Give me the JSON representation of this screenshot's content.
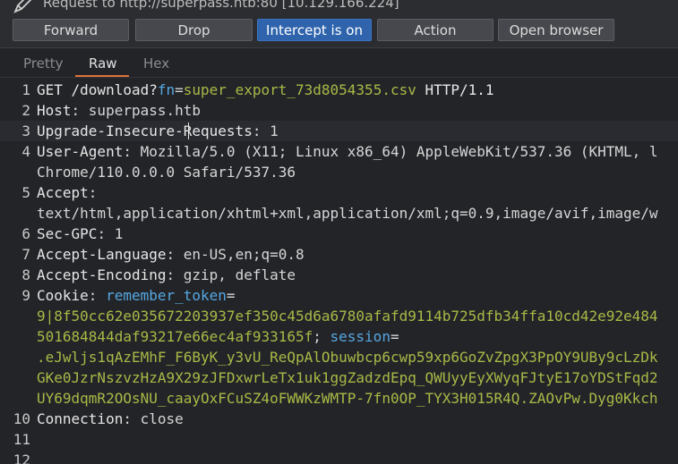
{
  "window": {
    "title": "Request to http://superpass.htb:80  [10.129.166.224]"
  },
  "toolbar": {
    "forward": "Forward",
    "drop": "Drop",
    "intercept": "Intercept is on",
    "action": "Action",
    "open_browser": "Open browser"
  },
  "tabs": [
    "Pretty",
    "Raw",
    "Hex"
  ],
  "lines": [
    {
      "num": "1",
      "parts": [
        {
          "t": "GET /download?",
          "c": "k"
        },
        {
          "t": "fn",
          "c": "b"
        },
        {
          "t": "=",
          "c": "w"
        },
        {
          "t": "super_export_73d8054355.csv",
          "c": "g"
        },
        {
          "t": " HTTP/1.1",
          "c": "k"
        }
      ]
    },
    {
      "num": "2",
      "parts": [
        {
          "t": "Host",
          "c": "k"
        },
        {
          "t": ": superpass.htb",
          "c": "w"
        }
      ]
    },
    {
      "num": "3",
      "parts": [
        {
          "t": "Upgrade-Insecure-Requests",
          "c": "k"
        },
        {
          "t": ": 1",
          "c": "w"
        }
      ]
    },
    {
      "num": "4",
      "parts": [
        {
          "t": "User-Agent",
          "c": "k"
        },
        {
          "t": ": Mozilla/5.0 (X11; Linux x86_64) AppleWebKit/537.36 (KHTML, l",
          "c": "w"
        }
      ]
    },
    {
      "num": "",
      "parts": [
        {
          "t": "Chrome/110.0.0.0 Safari/537.36",
          "c": "w"
        }
      ]
    },
    {
      "num": "5",
      "parts": [
        {
          "t": "Accept",
          "c": "k"
        },
        {
          "t": ":",
          "c": "w"
        }
      ]
    },
    {
      "num": "",
      "parts": [
        {
          "t": "text/html,application/xhtml+xml,application/xml;q=0.9,image/avif,image/w",
          "c": "w"
        }
      ]
    },
    {
      "num": "6",
      "parts": [
        {
          "t": "Sec-GPC",
          "c": "k"
        },
        {
          "t": ": 1",
          "c": "w"
        }
      ]
    },
    {
      "num": "7",
      "parts": [
        {
          "t": "Accept-Language",
          "c": "k"
        },
        {
          "t": ": en-US,en;q=0.8",
          "c": "w"
        }
      ]
    },
    {
      "num": "8",
      "parts": [
        {
          "t": "Accept-Encoding",
          "c": "k"
        },
        {
          "t": ": gzip, deflate",
          "c": "w"
        }
      ]
    },
    {
      "num": "9",
      "parts": [
        {
          "t": "Cookie",
          "c": "k"
        },
        {
          "t": ": ",
          "c": "w"
        },
        {
          "t": "remember_token",
          "c": "b"
        },
        {
          "t": "=",
          "c": "w"
        }
      ]
    },
    {
      "num": "",
      "parts": [
        {
          "t": "9|8f50cc62e035672203937ef350c45d6a6780afafd9114b725dfb34ffa10cd42e92e484",
          "c": "g"
        }
      ]
    },
    {
      "num": "",
      "parts": [
        {
          "t": "501684844daf93217e66ec4af933165f",
          "c": "g"
        },
        {
          "t": "; ",
          "c": "w"
        },
        {
          "t": "session",
          "c": "b"
        },
        {
          "t": "=",
          "c": "w"
        }
      ]
    },
    {
      "num": "",
      "parts": [
        {
          "t": ".eJwljs1qAzEMhF_F6ByK_y3vU_ReQpAlObuwbcp6cwp59xp6GoZvZpgX3PpOY9UBy9cLzDk",
          "c": "g"
        }
      ]
    },
    {
      "num": "",
      "parts": [
        {
          "t": "GKe0JzrNszvzHzA9X29zJFDxwrLeTx1uk1ggZadzdEpq_QWUyyEyXWyqFJtyE17oYDStFqd2",
          "c": "g"
        }
      ]
    },
    {
      "num": "",
      "parts": [
        {
          "t": "UY69dqmR2OOsNU_caayOxFCuSZ4oFWWKzWMTP-7fn0OP_TYX3H015R4Q.ZAOvPw.Dyg0Kkch",
          "c": "g"
        }
      ]
    },
    {
      "num": "10",
      "parts": [
        {
          "t": "Connection",
          "c": "k"
        },
        {
          "t": ": close",
          "c": "w"
        }
      ]
    },
    {
      "num": "11",
      "parts": []
    },
    {
      "num": "12",
      "parts": []
    }
  ],
  "colors": {
    "background": "#232428",
    "intercept_active": "#2f64ad",
    "tab_accent": "#e0713a",
    "value_green": "#a9b946",
    "param_blue": "#55a7e0"
  }
}
